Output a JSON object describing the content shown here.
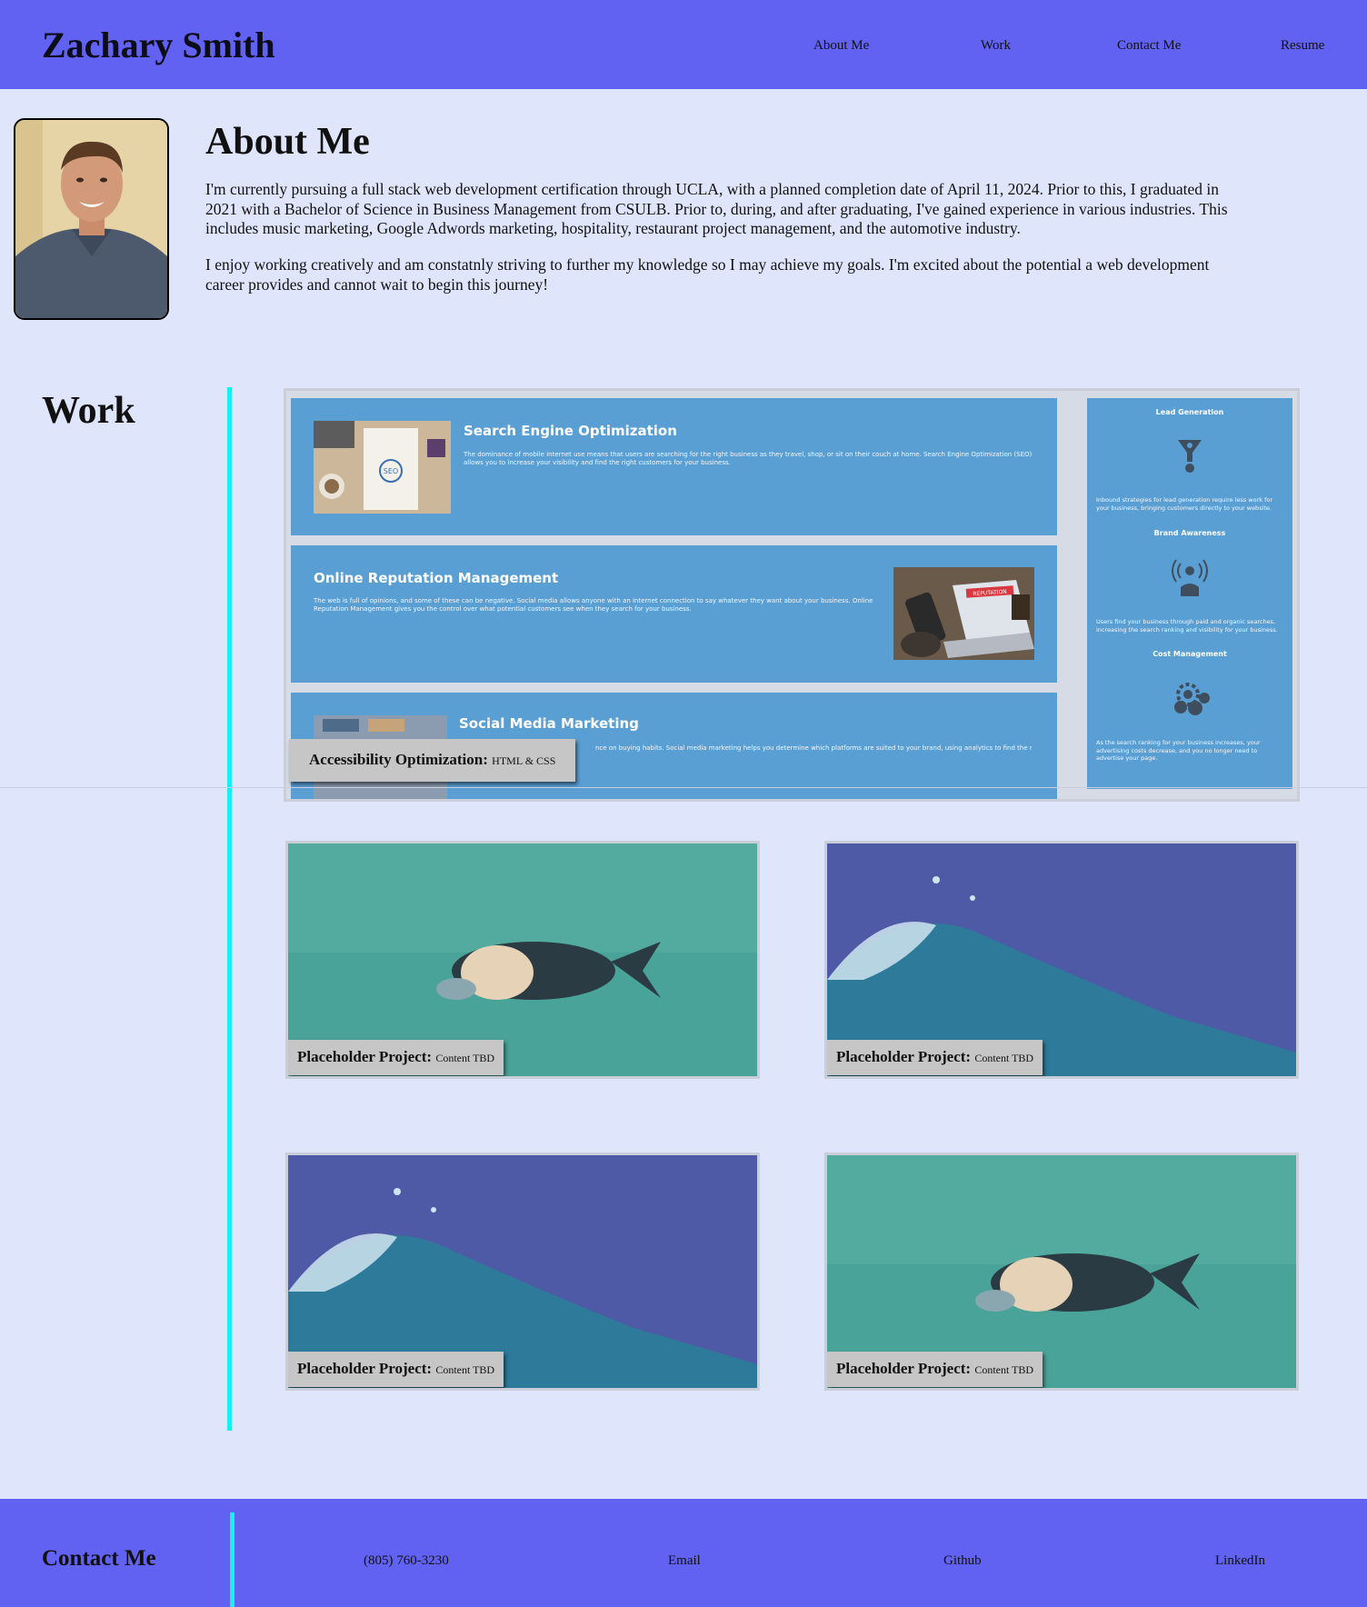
{
  "header": {
    "title": "Zachary Smith",
    "nav": [
      "About Me",
      "Work",
      "Contact Me",
      "Resume"
    ]
  },
  "about": {
    "heading": "About Me",
    "paragraphs": [
      "I'm currently pursuing a full stack web development certification through UCLA, with a planned completion date of April 11, 2024. Prior to this, I graduated in 2021 with a Bachelor of Science in Business Management from CSULB. Prior to, during, and after graduating, I've gained experience in various industries. This includes music marketing, Google Adwords marketing, hospitality, restaurant project management, and the automotive industry.",
      "I enjoy working creatively and am constatnly striving to further my knowledge so I may achieve my goals. I'm excited about the potential a web development career provides and cannot wait to begin this journey!"
    ]
  },
  "work": {
    "heading": "Work",
    "featured": {
      "label_title": "Accessibility Optimization:",
      "label_tech": "HTML & CSS",
      "cards": [
        {
          "title": "Search Engine Optimization",
          "text": "The dominance of mobile internet use means that users are searching for the right business as they travel, shop, or sit on their couch at home. Search Engine Optimization (SEO) allows you to increase your visibility and find the right customers for your business."
        },
        {
          "title": "Online Reputation Management",
          "text": "The web is full of opinions, and some of these can be negative. Social media allows anyone with an internet connection to say whatever they want about your business. Online Reputation Management gives you the control over what potential customers see when they search for your business."
        },
        {
          "title": "Social Media Marketing",
          "text": "nce on buying habits. Social media marketing helps you determine which platforms are suited to your brand, using analytics to find the right"
        }
      ],
      "side": [
        {
          "title": "Lead Generation",
          "text": "Inbound strategies for lead generation require less work for your business, bringing customers directly to your website."
        },
        {
          "title": "Brand Awareness",
          "text": "Users find your business through paid and organic searches, increasing the search ranking and visibility for your business."
        },
        {
          "title": "Cost Management",
          "text": "As the search ranking for your business increases, your advertising costs decrease, and you no longer need to advertise your page."
        }
      ],
      "seo_image_text": "SEO",
      "reputation_image_text": "REPUTATION"
    },
    "projects": [
      {
        "label_title": "Placeholder Project:",
        "label_tech": "Content TBD"
      },
      {
        "label_title": "Placeholder Project:",
        "label_tech": "Content TBD"
      },
      {
        "label_title": "Placeholder Project:",
        "label_tech": "Content TBD"
      },
      {
        "label_title": "Placeholder Project:",
        "label_tech": "Content TBD"
      }
    ]
  },
  "footer": {
    "heading": "Contact Me",
    "links": [
      "(805) 760-3230",
      "Email",
      "Github",
      "LinkedIn"
    ]
  },
  "colors": {
    "header_bg": "#6161f2",
    "page_bg": "#dfe5fb",
    "accent_bar": "#19eef0",
    "card_blue": "#5a9fd4"
  }
}
